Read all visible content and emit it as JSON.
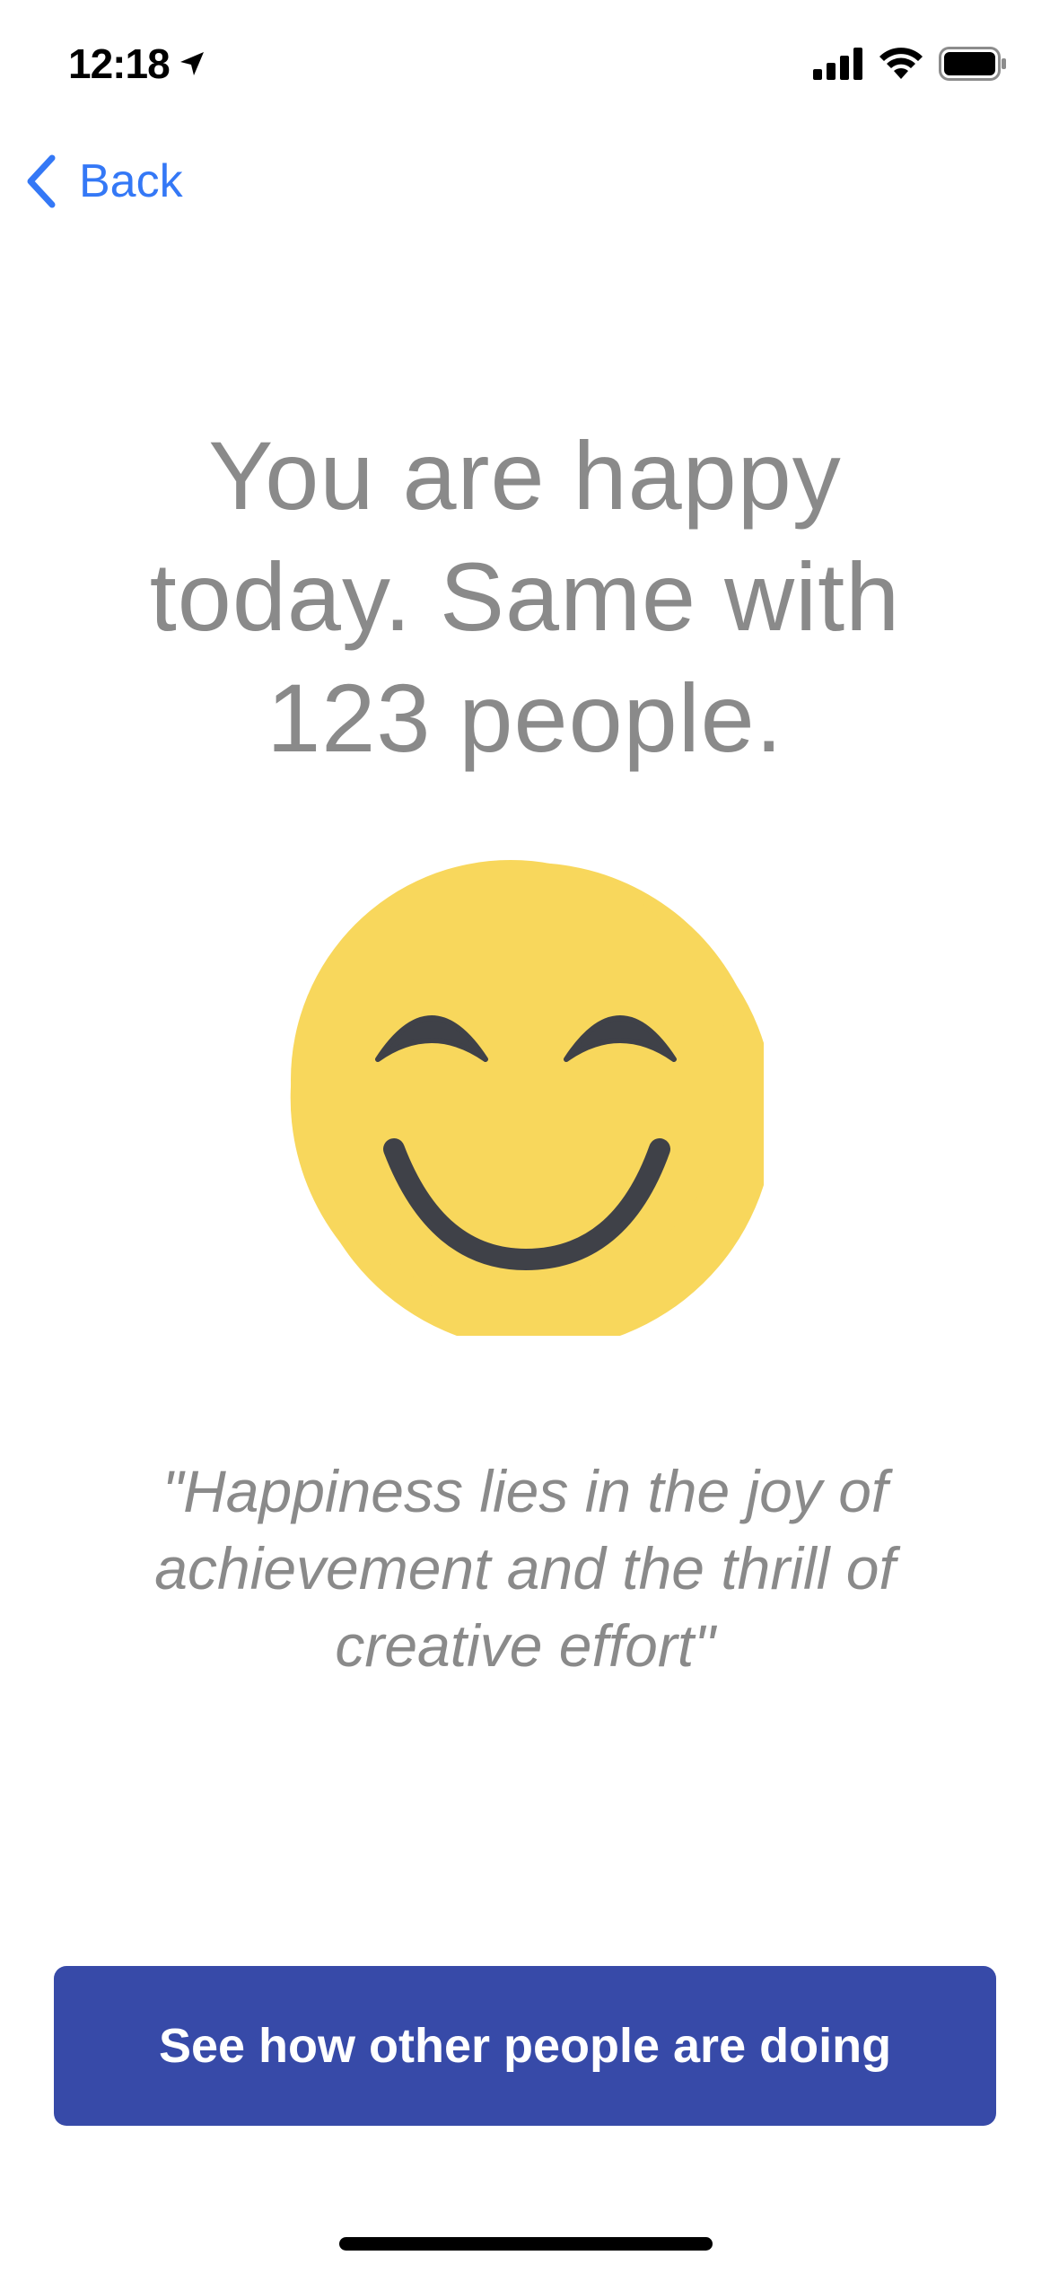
{
  "status_bar": {
    "time": "12:18",
    "icons": [
      "location-arrow-icon",
      "cellular-signal-icon",
      "wifi-icon",
      "battery-icon"
    ]
  },
  "navigation": {
    "back_label": "Back",
    "back_icon": "chevron-left-icon"
  },
  "main": {
    "headline_lines": [
      "You are happy",
      "today. Same with",
      "123 people."
    ],
    "emoji": "smiling-face-icon",
    "quote_lines": [
      "\"Happiness lies in the joy of",
      "achievement and the thrill of",
      "creative effort\""
    ]
  },
  "cta": {
    "label": "See how other people are doing"
  },
  "colors": {
    "accent_link": "#3478f6",
    "button_bg": "#374aa8",
    "text_muted": "#8a8a8a",
    "emoji_yellow": "#f8d75c",
    "emoji_shadow": "#eec752",
    "emoji_features": "#3f4148"
  }
}
